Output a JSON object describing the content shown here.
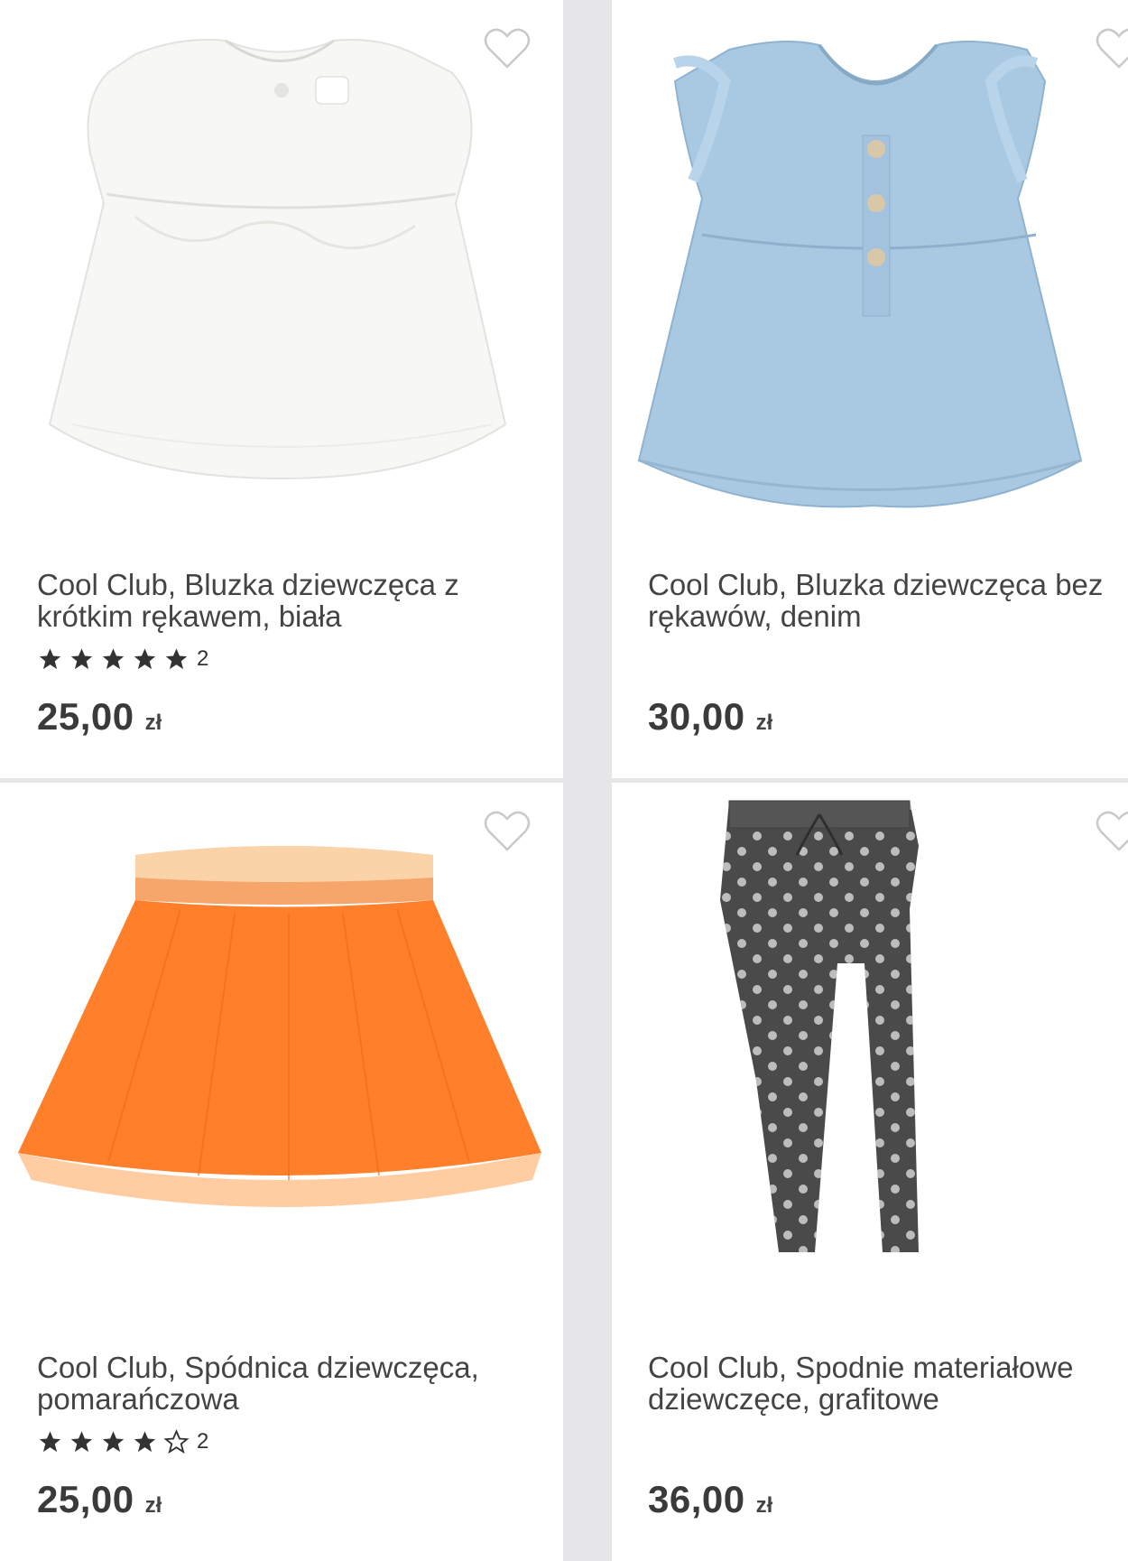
{
  "products": [
    {
      "title": "Cool Club, Bluzka dziewczęca z krótkim rękawem, biała",
      "rating_stars": 5,
      "rating_count": "2",
      "price": "25,00",
      "currency": "zł",
      "image": "white-girls-blouse",
      "favorite_icon": "heart-outline-icon"
    },
    {
      "title": "Cool Club, Bluzka dziewczęca bez rękawów, denim",
      "price": "30,00",
      "currency": "zł",
      "image": "denim-sleeveless-blouse",
      "favorite_icon": "heart-outline-icon"
    },
    {
      "title": "Cool Club, Spódnica dziewczęca, pomarańczowa",
      "rating_stars": 4,
      "rating_count": "2",
      "price": "25,00",
      "currency": "zł",
      "image": "orange-tulle-skirt",
      "favorite_icon": "heart-outline-icon"
    },
    {
      "title": "Cool Club, Spodnie materiałowe dziewczęce, grafitowe",
      "price": "36,00",
      "currency": "zł",
      "image": "graphite-polka-dot-pants",
      "favorite_icon": "heart-outline-icon"
    }
  ],
  "colors": {
    "background": "#e6e6e8",
    "card": "#ffffff",
    "text": "#444444",
    "star": "#333333"
  }
}
